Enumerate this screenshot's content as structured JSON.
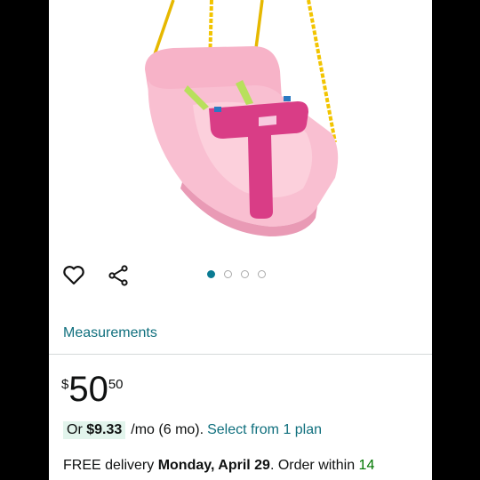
{
  "product": {
    "image_alt": "Pink toddler swing seat with yellow ropes",
    "carousel": {
      "total": 4,
      "active_index": 0
    }
  },
  "actions": {
    "wishlist_icon": "heart-icon",
    "share_icon": "share-icon"
  },
  "links": {
    "measurements": "Measurements"
  },
  "price": {
    "symbol": "$",
    "whole": "50",
    "fraction": "50"
  },
  "plan": {
    "prefix": "Or",
    "amount": "$9.33",
    "middle": "/mo (6 mo).",
    "link": "Select from 1 plan"
  },
  "delivery": {
    "prefix": "FREE delivery",
    "date": "Monday, April 29",
    "suffix": ". Order within",
    "time_left": "14"
  },
  "colors": {
    "link": "#0f6f7d",
    "carousel_active": "#0a7b93",
    "plan_highlight_bg": "#e2f4ec",
    "seat_pink": "#f8b8cc",
    "tbar_magenta": "#d93d86",
    "rope_yellow": "#f2c400"
  }
}
